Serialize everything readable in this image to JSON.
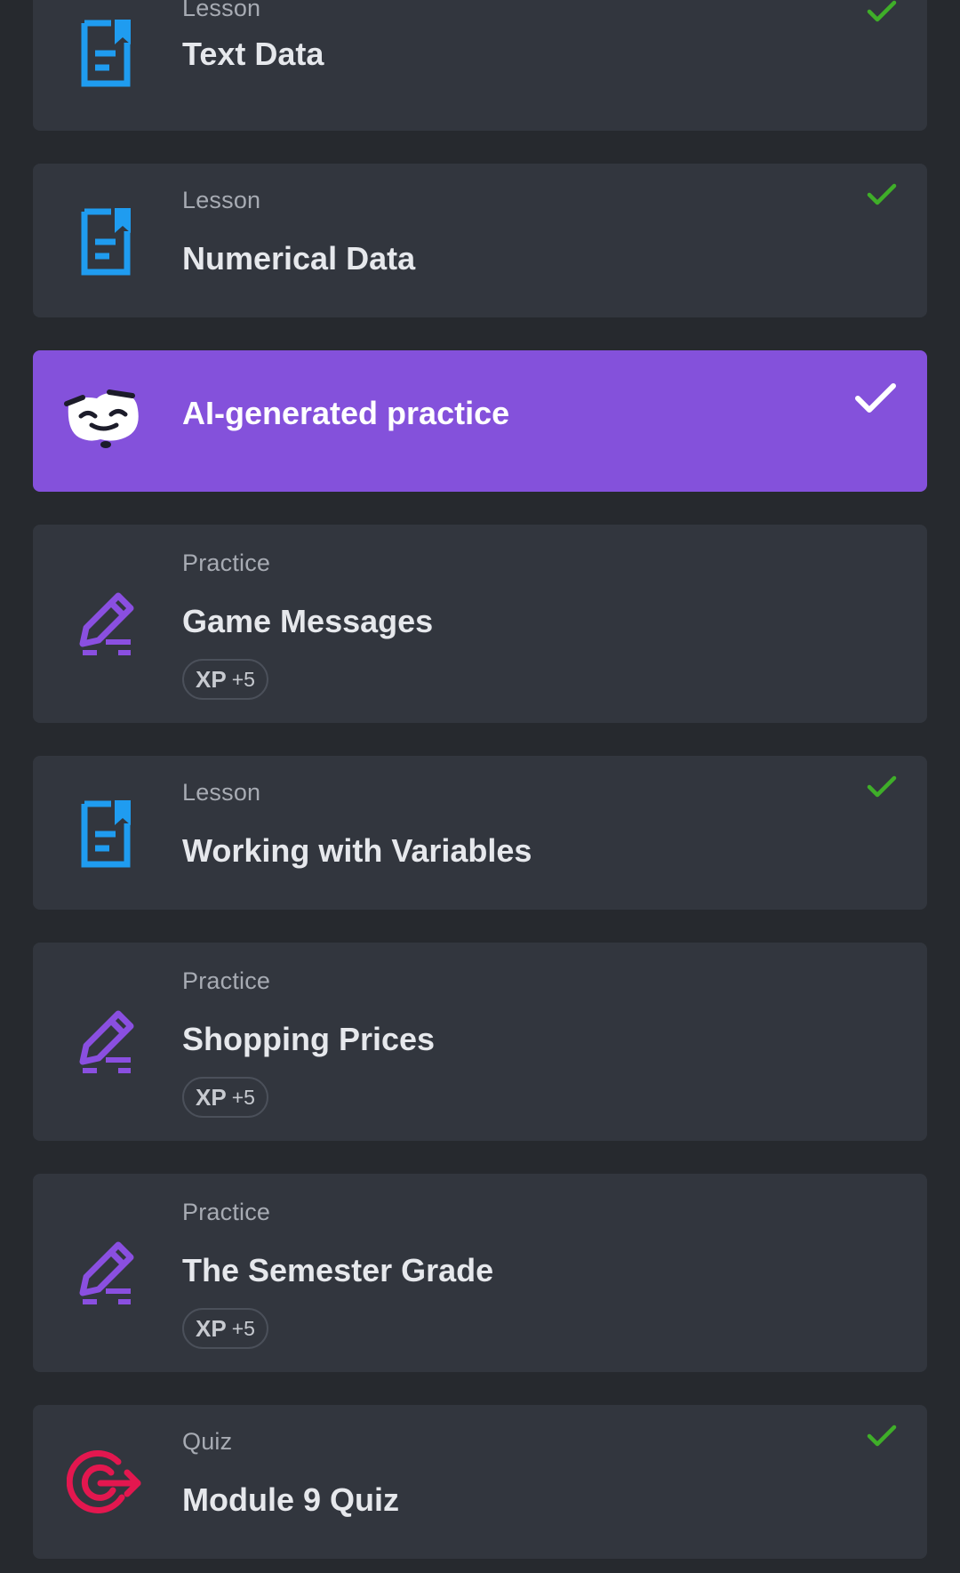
{
  "items": [
    {
      "type": "Lesson",
      "title": "Text Data",
      "completed": true,
      "icon": "lesson-bookmark-icon"
    },
    {
      "type": "Lesson",
      "title": "Numerical Data",
      "completed": true,
      "icon": "lesson-bookmark-icon"
    },
    {
      "title": "AI-generated practice",
      "completed": true,
      "icon": "ai-mascot-icon",
      "highlighted": true
    },
    {
      "type": "Practice",
      "title": "Game Messages",
      "xp_label": "XP",
      "xp_value": "+5",
      "icon": "practice-pencil-icon"
    },
    {
      "type": "Lesson",
      "title": "Working with Variables",
      "completed": true,
      "icon": "lesson-bookmark-icon"
    },
    {
      "type": "Practice",
      "title": "Shopping Prices",
      "xp_label": "XP",
      "xp_value": "+5",
      "icon": "practice-pencil-icon"
    },
    {
      "type": "Practice",
      "title": "The Semester Grade",
      "xp_label": "XP",
      "xp_value": "+5",
      "icon": "practice-pencil-icon"
    },
    {
      "type": "Quiz",
      "title": "Module 9 Quiz",
      "completed": true,
      "icon": "quiz-target-icon"
    }
  ],
  "colors": {
    "background": "#26292e",
    "card": "#32363e",
    "ai_card": "#8451db",
    "lesson_icon": "#1f9cf0",
    "practice_icon": "#8a4fe0",
    "quiz_icon": "#e3174f",
    "check": "#3fae29"
  }
}
